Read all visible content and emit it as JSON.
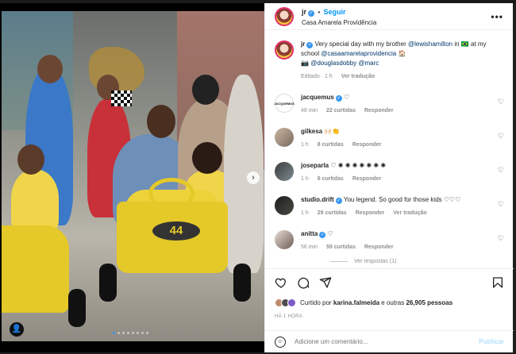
{
  "header": {
    "username": "jr",
    "follow_label": "Seguir",
    "location": "Casa Amarela Providência",
    "more_label": "•••"
  },
  "caption": {
    "username": "jr",
    "text_before": "Very special day with my brother",
    "mention_1": "@lewishamilton",
    "text_mid": "in 🇧🇷 at my school",
    "mention_2": "@casaamarelaprovidencia",
    "emoji": "🏠",
    "camera": "📷",
    "mention_3": "@douglasdobby",
    "mention_4": "@marc",
    "edited": "Editado · 1 h",
    "see_translation": "Ver tradução"
  },
  "comments": [
    {
      "username": "jacquemus",
      "avatar_text": "JACQUEMUS",
      "text": "♡",
      "time": "48 min",
      "likes": "22 curtidas",
      "reply": "Responder",
      "translate": ""
    },
    {
      "username": "gilkesa",
      "text": "🙌🏻👏",
      "time": "1 h",
      "likes": "8 curtidas",
      "reply": "Responder",
      "translate": ""
    },
    {
      "username": "joseparla",
      "text": "♡ ✺ ✺ ✺ ✺ ✺ ✺ ✺",
      "time": "1 h",
      "likes": "6 curtidas",
      "reply": "Responder",
      "translate": ""
    },
    {
      "username": "studio.drift",
      "text": "You legend. So good for those kids ♡♡♡",
      "time": "1 h",
      "likes": "29 curtidas",
      "reply": "Responder",
      "translate": "Ver tradução"
    },
    {
      "username": "anitta",
      "text": "♡",
      "time": "56 min",
      "likes": "59 curtidas",
      "reply": "Responder",
      "translate": ""
    }
  ],
  "view_replies": "Ver respostas (1)",
  "likes_line": {
    "prefix": "Curtido por",
    "user": "karina.falmeida",
    "suffix": "e outras",
    "count": "26,905",
    "suffix2": "pessoas"
  },
  "time_ago": "HÁ 1 HORA",
  "add_comment": {
    "placeholder": "Adicione um comentário...",
    "publish": "Publicar"
  },
  "media": {
    "kart_number": "44",
    "next_arrow": "›",
    "user_tag_icon": "user-icon"
  },
  "colors": {
    "accent": "#0095f6",
    "verified": "#3897f0",
    "kart_yellow": "#e4c928"
  }
}
